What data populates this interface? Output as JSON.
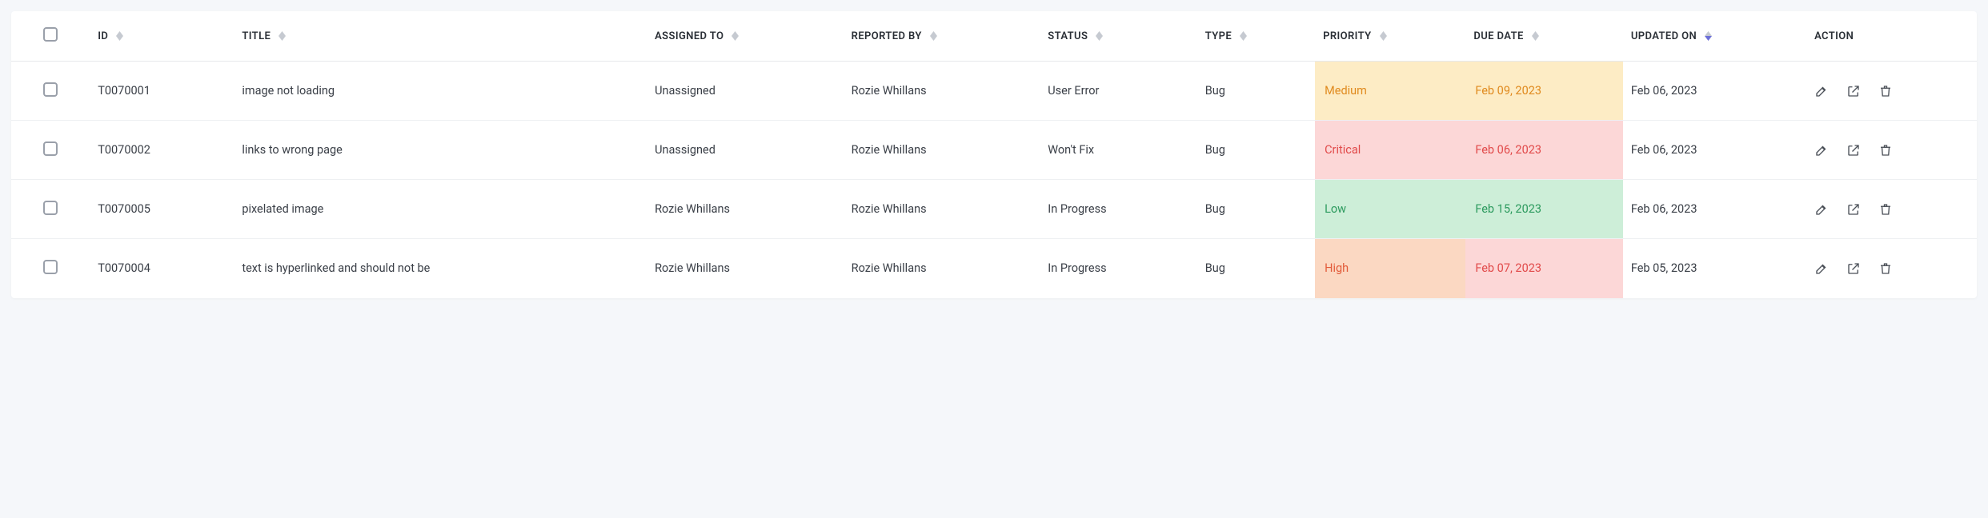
{
  "columns": {
    "id": "ID",
    "title": "TITLE",
    "assigned_to": "ASSIGNED TO",
    "reported_by": "REPORTED BY",
    "status": "STATUS",
    "type": "TYPE",
    "priority": "PRIORITY",
    "due_date": "DUE DATE",
    "updated_on": "UPDATED ON",
    "action": "ACTION"
  },
  "sort": {
    "column": "updated_on",
    "direction": "desc"
  },
  "rows": [
    {
      "id": "T0070001",
      "title": "image not loading",
      "assigned_to": "Unassigned",
      "reported_by": "Rozie Whillans",
      "status": "User Error",
      "type": "Bug",
      "priority": "Medium",
      "priority_level": "medium",
      "due_date": "Feb 09, 2023",
      "updated_on": "Feb 06, 2023"
    },
    {
      "id": "T0070002",
      "title": "links to wrong page",
      "assigned_to": "Unassigned",
      "reported_by": "Rozie Whillans",
      "status": "Won't Fix",
      "type": "Bug",
      "priority": "Critical",
      "priority_level": "critical",
      "due_date": "Feb 06, 2023",
      "updated_on": "Feb 06, 2023"
    },
    {
      "id": "T0070005",
      "title": "pixelated image",
      "assigned_to": "Rozie Whillans",
      "reported_by": "Rozie Whillans",
      "status": "In Progress",
      "type": "Bug",
      "priority": "Low",
      "priority_level": "low",
      "due_date": "Feb 15, 2023",
      "updated_on": "Feb 06, 2023"
    },
    {
      "id": "T0070004",
      "title": "text is hyperlinked and should not be",
      "assigned_to": "Rozie Whillans",
      "reported_by": "Rozie Whillans",
      "status": "In Progress",
      "type": "Bug",
      "priority": "High",
      "priority_level": "high",
      "due_date": "Feb 07, 2023",
      "updated_on": "Feb 05, 2023"
    }
  ]
}
